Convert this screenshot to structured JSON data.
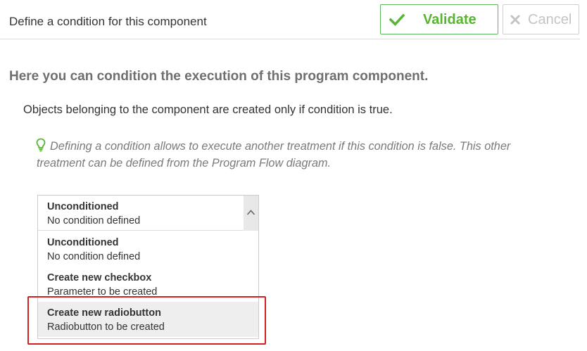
{
  "header": {
    "title": "Define a condition for this component",
    "validate_label": "Validate",
    "cancel_label": "Cancel"
  },
  "content": {
    "heading": "Here you can condition the execution of this program component.",
    "intro": "Objects belonging to the component are created only if condition is true.",
    "hint": "Defining a condition allows to execute another treatment if this condition is false. This other treatment can be defined from the Program Flow diagram."
  },
  "condition_select": {
    "selected": {
      "title": "Unconditioned",
      "subtitle": "No condition defined"
    },
    "options": [
      {
        "title": "Unconditioned",
        "subtitle": "No condition defined"
      },
      {
        "title": "Create new checkbox",
        "subtitle": "Parameter to be created"
      },
      {
        "title": "Create new radiobutton",
        "subtitle": "Radiobutton to be created"
      }
    ]
  },
  "colors": {
    "validate_green": "#58b531",
    "annotation_red": "#d42020",
    "hint_icon_green": "#58b531",
    "highlight_gray": "#eeeeee"
  },
  "icons": {
    "validate": "check-icon",
    "cancel": "close-icon",
    "hint": "lightbulb-icon",
    "scroll": "chevron-up-icon"
  }
}
